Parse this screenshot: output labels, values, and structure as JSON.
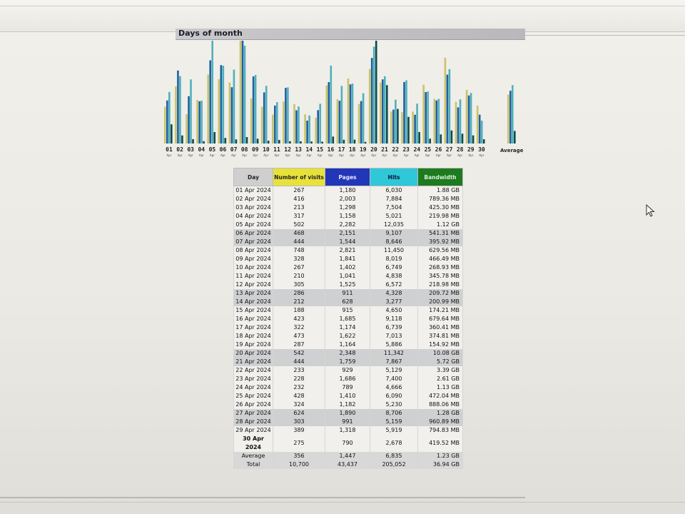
{
  "section": {
    "title": "Days of month"
  },
  "colors": {
    "visits": "#c9c36a",
    "pages": "#1f5fa0",
    "hits": "#4fb0bd",
    "bandwidth": "#0d4a4a"
  },
  "chart_data": {
    "type": "bar",
    "title": "Days of month",
    "categories": [
      "01",
      "02",
      "03",
      "04",
      "05",
      "06",
      "07",
      "08",
      "09",
      "10",
      "11",
      "12",
      "13",
      "14",
      "15",
      "16",
      "17",
      "18",
      "19",
      "20",
      "21",
      "22",
      "23",
      "24",
      "25",
      "26",
      "27",
      "28",
      "29",
      "30"
    ],
    "month_label": "Apr",
    "average_label": "Average",
    "series": [
      {
        "name": "Number of visits",
        "values": [
          267,
          416,
          213,
          317,
          502,
          468,
          444,
          748,
          328,
          267,
          210,
          305,
          286,
          212,
          188,
          423,
          322,
          473,
          287,
          542,
          444,
          233,
          228,
          232,
          428,
          324,
          624,
          303,
          389,
          275
        ],
        "average": 356
      },
      {
        "name": "Pages",
        "values": [
          1180,
          2003,
          1298,
          1158,
          2282,
          2151,
          1544,
          2821,
          1841,
          1402,
          1041,
          1525,
          911,
          628,
          915,
          1685,
          1174,
          1622,
          1164,
          2348,
          1759,
          929,
          1686,
          789,
          1410,
          1182,
          1890,
          991,
          1318,
          790
        ],
        "average": 1447
      },
      {
        "name": "Hits",
        "values": [
          6030,
          7884,
          7504,
          5021,
          12035,
          9107,
          8646,
          11450,
          8019,
          6749,
          4838,
          6572,
          4328,
          3277,
          4650,
          9118,
          6739,
          7013,
          5886,
          11342,
          7867,
          5129,
          7400,
          4666,
          6090,
          5230,
          8706,
          5159,
          5919,
          2678
        ],
        "average": 6835
      },
      {
        "name": "Bandwidth",
        "values": [
          1.88,
          0.789,
          0.425,
          0.22,
          1.12,
          0.541,
          0.396,
          0.63,
          0.466,
          0.269,
          0.346,
          0.219,
          0.21,
          0.201,
          0.174,
          0.68,
          0.36,
          0.375,
          0.155,
          10.08,
          5.72,
          3.39,
          2.61,
          1.13,
          0.472,
          0.888,
          1.28,
          0.961,
          0.795,
          0.42
        ],
        "average": 1.23,
        "unit": "GB"
      }
    ]
  },
  "table": {
    "headers": {
      "day": "Day",
      "visits": "Number of visits",
      "pages": "Pages",
      "hits": "Hits",
      "bandwidth": "Bandwidth"
    },
    "rows": [
      {
        "day": "01 Apr 2024",
        "visits": "267",
        "pages": "1,180",
        "hits": "6,030",
        "bandwidth": "1.88 GB",
        "weekend": false
      },
      {
        "day": "02 Apr 2024",
        "visits": "416",
        "pages": "2,003",
        "hits": "7,884",
        "bandwidth": "789.36 MB",
        "weekend": false
      },
      {
        "day": "03 Apr 2024",
        "visits": "213",
        "pages": "1,298",
        "hits": "7,504",
        "bandwidth": "425.30 MB",
        "weekend": false
      },
      {
        "day": "04 Apr 2024",
        "visits": "317",
        "pages": "1,158",
        "hits": "5,021",
        "bandwidth": "219.98 MB",
        "weekend": false
      },
      {
        "day": "05 Apr 2024",
        "visits": "502",
        "pages": "2,282",
        "hits": "12,035",
        "bandwidth": "1.12 GB",
        "weekend": false
      },
      {
        "day": "06 Apr 2024",
        "visits": "468",
        "pages": "2,151",
        "hits": "9,107",
        "bandwidth": "541.31 MB",
        "weekend": true
      },
      {
        "day": "07 Apr 2024",
        "visits": "444",
        "pages": "1,544",
        "hits": "8,646",
        "bandwidth": "395.92 MB",
        "weekend": true
      },
      {
        "day": "08 Apr 2024",
        "visits": "748",
        "pages": "2,821",
        "hits": "11,450",
        "bandwidth": "629.56 MB",
        "weekend": false
      },
      {
        "day": "09 Apr 2024",
        "visits": "328",
        "pages": "1,841",
        "hits": "8,019",
        "bandwidth": "466.49 MB",
        "weekend": false
      },
      {
        "day": "10 Apr 2024",
        "visits": "267",
        "pages": "1,402",
        "hits": "6,749",
        "bandwidth": "268.93 MB",
        "weekend": false
      },
      {
        "day": "11 Apr 2024",
        "visits": "210",
        "pages": "1,041",
        "hits": "4,838",
        "bandwidth": "345.78 MB",
        "weekend": false
      },
      {
        "day": "12 Apr 2024",
        "visits": "305",
        "pages": "1,525",
        "hits": "6,572",
        "bandwidth": "218.98 MB",
        "weekend": false
      },
      {
        "day": "13 Apr 2024",
        "visits": "286",
        "pages": "911",
        "hits": "4,328",
        "bandwidth": "209.72 MB",
        "weekend": true
      },
      {
        "day": "14 Apr 2024",
        "visits": "212",
        "pages": "628",
        "hits": "3,277",
        "bandwidth": "200.99 MB",
        "weekend": true
      },
      {
        "day": "15 Apr 2024",
        "visits": "188",
        "pages": "915",
        "hits": "4,650",
        "bandwidth": "174.21 MB",
        "weekend": false
      },
      {
        "day": "16 Apr 2024",
        "visits": "423",
        "pages": "1,685",
        "hits": "9,118",
        "bandwidth": "679.64 MB",
        "weekend": false
      },
      {
        "day": "17 Apr 2024",
        "visits": "322",
        "pages": "1,174",
        "hits": "6,739",
        "bandwidth": "360.41 MB",
        "weekend": false
      },
      {
        "day": "18 Apr 2024",
        "visits": "473",
        "pages": "1,622",
        "hits": "7,013",
        "bandwidth": "374.81 MB",
        "weekend": false
      },
      {
        "day": "19 Apr 2024",
        "visits": "287",
        "pages": "1,164",
        "hits": "5,886",
        "bandwidth": "154.92 MB",
        "weekend": false
      },
      {
        "day": "20 Apr 2024",
        "visits": "542",
        "pages": "2,348",
        "hits": "11,342",
        "bandwidth": "10.08 GB",
        "weekend": true
      },
      {
        "day": "21 Apr 2024",
        "visits": "444",
        "pages": "1,759",
        "hits": "7,867",
        "bandwidth": "5.72 GB",
        "weekend": true
      },
      {
        "day": "22 Apr 2024",
        "visits": "233",
        "pages": "929",
        "hits": "5,129",
        "bandwidth": "3.39 GB",
        "weekend": false
      },
      {
        "day": "23 Apr 2024",
        "visits": "228",
        "pages": "1,686",
        "hits": "7,400",
        "bandwidth": "2.61 GB",
        "weekend": false
      },
      {
        "day": "24 Apr 2024",
        "visits": "232",
        "pages": "789",
        "hits": "4,666",
        "bandwidth": "1.13 GB",
        "weekend": false
      },
      {
        "day": "25 Apr 2024",
        "visits": "428",
        "pages": "1,410",
        "hits": "6,090",
        "bandwidth": "472.04 MB",
        "weekend": false
      },
      {
        "day": "26 Apr 2024",
        "visits": "324",
        "pages": "1,182",
        "hits": "5,230",
        "bandwidth": "888.06 MB",
        "weekend": false
      },
      {
        "day": "27 Apr 2024",
        "visits": "624",
        "pages": "1,890",
        "hits": "8,706",
        "bandwidth": "1.28 GB",
        "weekend": true
      },
      {
        "day": "28 Apr 2024",
        "visits": "303",
        "pages": "991",
        "hits": "5,159",
        "bandwidth": "960.89 MB",
        "weekend": true
      },
      {
        "day": "29 Apr 2024",
        "visits": "389",
        "pages": "1,318",
        "hits": "5,919",
        "bandwidth": "794.83 MB",
        "weekend": false
      },
      {
        "day": "30 Apr 2024",
        "visits": "275",
        "pages": "790",
        "hits": "2,678",
        "bandwidth": "419.52 MB",
        "weekend": false,
        "today": true
      }
    ],
    "average": {
      "day": "Average",
      "visits": "356",
      "pages": "1,447",
      "hits": "6,835",
      "bandwidth": "1.23 GB"
    },
    "total": {
      "day": "Total",
      "visits": "10,700",
      "pages": "43,437",
      "hits": "205,052",
      "bandwidth": "36.94 GB"
    }
  }
}
